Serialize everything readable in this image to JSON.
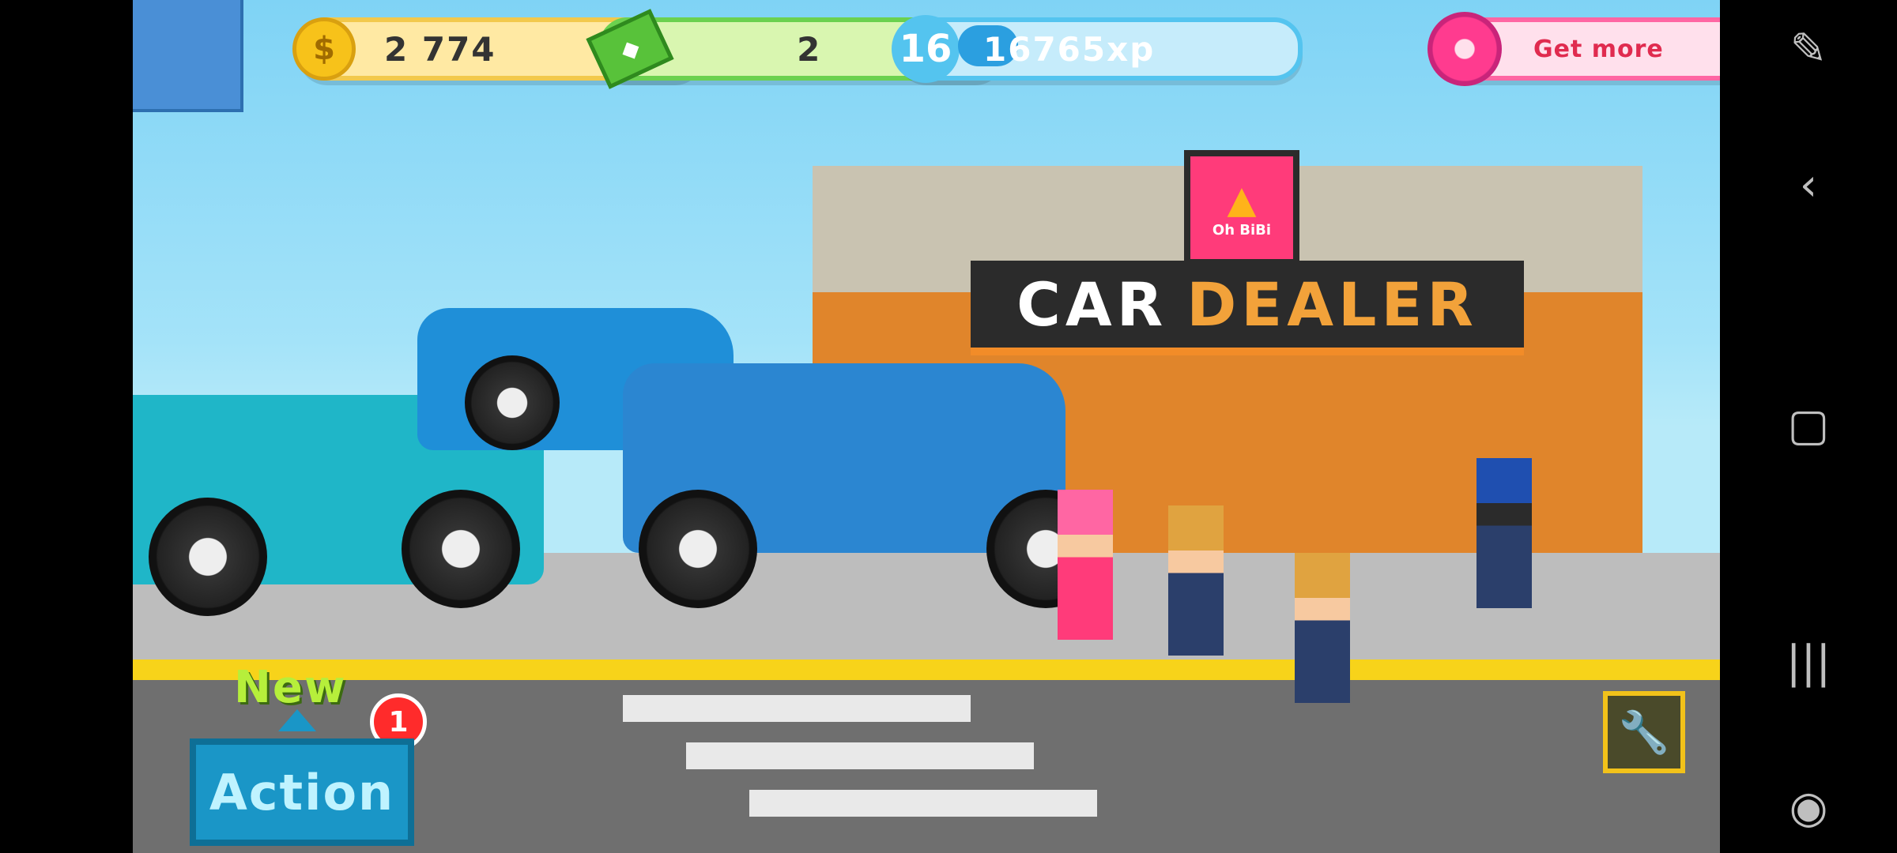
{
  "hud": {
    "coins": {
      "value": "2 774",
      "icon": "dollar-coin-icon",
      "plus": "+"
    },
    "cash": {
      "value": "2",
      "icon": "banknote-icon",
      "plus": "+"
    },
    "xp": {
      "level": "16",
      "value": "16765xp",
      "progress_fraction": 0.2
    },
    "donut": {
      "label": "Get more",
      "icon": "donut-icon"
    }
  },
  "scene": {
    "sign_left": "CAR",
    "sign_right": "DEALER",
    "logo_text": "Oh BiBi"
  },
  "actions": {
    "new_label": "New",
    "badge_count": "1",
    "action_label": "Action"
  },
  "colors": {
    "sky": "#7fd3f5",
    "coin_border": "#f2c94c",
    "cash_border": "#6bd14f",
    "xp_border": "#54c4ef",
    "donut_border": "#ff66a3",
    "building": "#e0852b",
    "accent_orange": "#f2a23a"
  },
  "nav": {
    "icons": [
      "edit-icon",
      "back-icon",
      "home-icon",
      "recents-icon",
      "gamepad-icon"
    ]
  }
}
